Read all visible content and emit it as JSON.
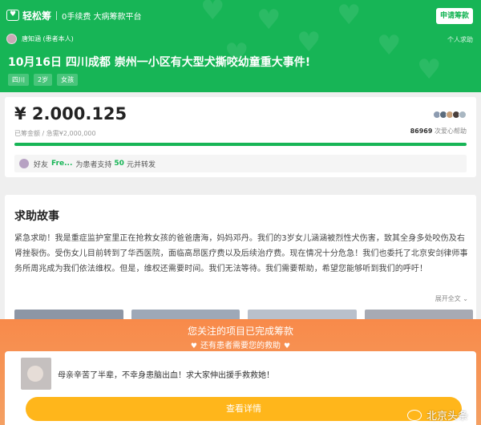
{
  "header": {
    "logo_text": "轻松筹",
    "tagline": "0手续费 大病筹款平台",
    "apply_button": "申请筹款",
    "author": "唐知涵 (患者本人)",
    "personal_label": "个人求助",
    "headline": "10月16日 四川成都 崇州一小区有大型犬撕咬幼童重大事件!",
    "tags": [
      "四川",
      "2岁",
      "女孩"
    ]
  },
  "funds": {
    "amount": "¥ 2.000.125",
    "target_text": "已筹金额 / 急需¥2,000,000",
    "helpers_count": "86969",
    "helpers_suffix": "次爱心帮助",
    "progress_fraction": 1.0
  },
  "share": {
    "prefix": "好友",
    "name": "Fre...",
    "text_1": "为患者支持",
    "amount": "50",
    "text_2": "元并转发"
  },
  "story": {
    "title": "求助故事",
    "body": "紧急求助！我是重症监护室里正在抢救女孩的爸爸唐海，妈妈邓丹。我们的3岁女儿涵涵被烈性犬伤害，致其全身多处咬伤及右肾挫裂伤。受伤女儿目前转到了华西医院，面临高昂医疗费以及后续治疗费。现在情况十分危急！我们也委托了北京安剑律师事务所周兆成为我们依法维权。但是，维权还需要时间。我们无法等待。我们需要帮助，希望您能够听到我们的呼吁！",
    "expand_label": "展开全文"
  },
  "overlay": {
    "title": "您关注的项目已完成筹款",
    "subtitle": "还有患者需要您的救助",
    "case_text": "母亲辛苦了半辈，不幸身患脑出血！求大家伸出援手救救她！",
    "details_button": "查看详情"
  },
  "watermark": "北京头条",
  "colors": {
    "brand_green": "#17b556",
    "overlay_orange": "#f88a4a",
    "button_yellow": "#ffb61b"
  },
  "icons": {
    "heart": "heart-icon",
    "weibo": "weibo-icon"
  }
}
